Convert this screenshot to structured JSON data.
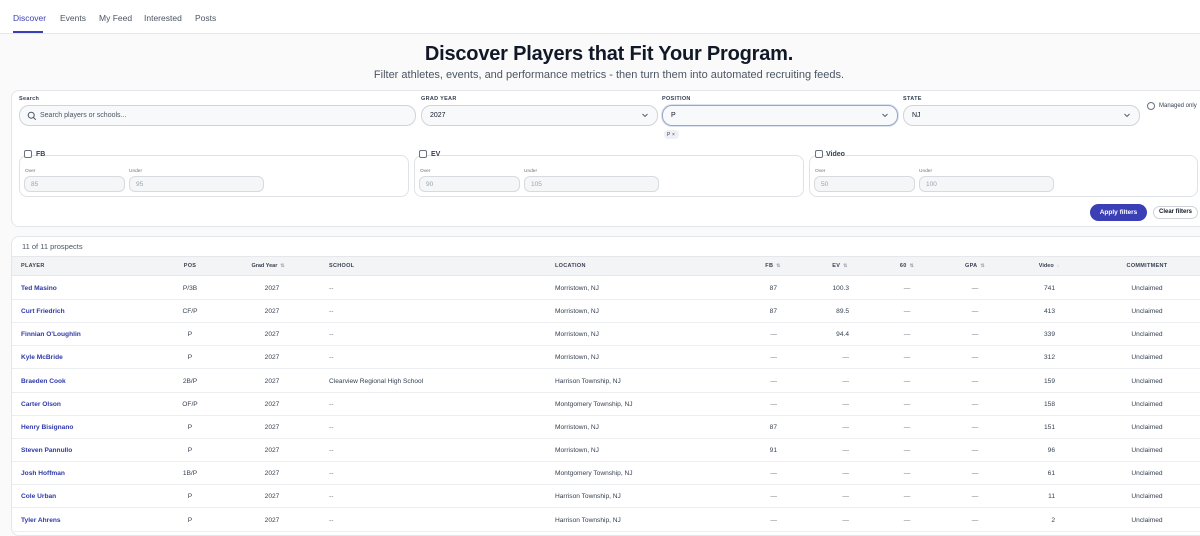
{
  "nav": {
    "tabs": [
      "Discover",
      "Events",
      "My Feed",
      "Interested",
      "Posts"
    ]
  },
  "hero": {
    "title": "Discover Players that Fit Your Program.",
    "subtitle": "Filter athletes, events, and performance metrics - then turn them into automated recruiting feeds."
  },
  "filters": {
    "search_label": "Search",
    "search_placeholder": "Search players or schools...",
    "grad_year_label": "GRAD YEAR",
    "grad_year_value": "2027",
    "position_label": "POSITION",
    "position_value": "P",
    "position_chip": "P",
    "position_chip_remove": "×",
    "state_label": "STATE",
    "state_value": "NJ",
    "managed_only_label": "Managed only",
    "metrics": [
      {
        "label": "FB",
        "over_label": "Over",
        "under_label": "Under",
        "over_placeholder": "85",
        "under_placeholder": "95"
      },
      {
        "label": "EV",
        "over_label": "Over",
        "under_label": "Under",
        "over_placeholder": "90",
        "under_placeholder": "105"
      },
      {
        "label": "Video",
        "over_label": "Over",
        "under_label": "Under",
        "over_placeholder": "50",
        "under_placeholder": "100"
      }
    ],
    "apply_label": "Apply filters",
    "clear_label": "Clear filters"
  },
  "results": {
    "count_text": "11 of 11 prospects",
    "columns": [
      "PLAYER",
      "POS",
      "Grad Year",
      "SCHOOL",
      "LOCATION",
      "FB",
      "EV",
      "60",
      "GPA",
      "Video",
      "COMMITMENT"
    ],
    "sort_asc_icon": "⇅",
    "sort_desc_icon": "↓",
    "rows": [
      {
        "player": "Ted Masino",
        "pos": "P/3B",
        "grad": "2027",
        "school": "--",
        "location": "Morristown, NJ",
        "fb": "87",
        "ev": "100.3",
        "sixty": "—",
        "gpa": "—",
        "video": "741",
        "commitment": "Unclaimed"
      },
      {
        "player": "Curt Friedrich",
        "pos": "CF/P",
        "grad": "2027",
        "school": "--",
        "location": "Morristown, NJ",
        "fb": "87",
        "ev": "89.5",
        "sixty": "—",
        "gpa": "—",
        "video": "413",
        "commitment": "Unclaimed"
      },
      {
        "player": "Finnian O'Loughlin",
        "pos": "P",
        "grad": "2027",
        "school": "--",
        "location": "Morristown, NJ",
        "fb": "—",
        "ev": "94.4",
        "sixty": "—",
        "gpa": "—",
        "video": "339",
        "commitment": "Unclaimed"
      },
      {
        "player": "Kyle McBride",
        "pos": "P",
        "grad": "2027",
        "school": "--",
        "location": "Morristown, NJ",
        "fb": "—",
        "ev": "—",
        "sixty": "—",
        "gpa": "—",
        "video": "312",
        "commitment": "Unclaimed"
      },
      {
        "player": "Braeden Cook",
        "pos": "2B/P",
        "grad": "2027",
        "school": "Clearview Regional High School",
        "location": "Harrison Township, NJ",
        "fb": "—",
        "ev": "—",
        "sixty": "—",
        "gpa": "—",
        "video": "159",
        "commitment": "Unclaimed"
      },
      {
        "player": "Carter Olson",
        "pos": "OF/P",
        "grad": "2027",
        "school": "--",
        "location": "Montgomery Township, NJ",
        "fb": "—",
        "ev": "—",
        "sixty": "—",
        "gpa": "—",
        "video": "158",
        "commitment": "Unclaimed"
      },
      {
        "player": "Henry Bisignano",
        "pos": "P",
        "grad": "2027",
        "school": "--",
        "location": "Morristown, NJ",
        "fb": "87",
        "ev": "—",
        "sixty": "—",
        "gpa": "—",
        "video": "151",
        "commitment": "Unclaimed"
      },
      {
        "player": "Steven Pannullo",
        "pos": "P",
        "grad": "2027",
        "school": "--",
        "location": "Morristown, NJ",
        "fb": "91",
        "ev": "—",
        "sixty": "—",
        "gpa": "—",
        "video": "96",
        "commitment": "Unclaimed"
      },
      {
        "player": "Josh Hoffman",
        "pos": "1B/P",
        "grad": "2027",
        "school": "--",
        "location": "Montgomery Township, NJ",
        "fb": "—",
        "ev": "—",
        "sixty": "—",
        "gpa": "—",
        "video": "61",
        "commitment": "Unclaimed"
      },
      {
        "player": "Cole Urban",
        "pos": "P",
        "grad": "2027",
        "school": "--",
        "location": "Harrison Township, NJ",
        "fb": "—",
        "ev": "—",
        "sixty": "—",
        "gpa": "—",
        "video": "11",
        "commitment": "Unclaimed"
      },
      {
        "player": "Tyler Ahrens",
        "pos": "P",
        "grad": "2027",
        "school": "--",
        "location": "Harrison Township, NJ",
        "fb": "—",
        "ev": "—",
        "sixty": "—",
        "gpa": "—",
        "video": "2",
        "commitment": "Unclaimed"
      }
    ]
  },
  "colors": {
    "accent": "#3b3fb6",
    "link": "#2f3aa8"
  }
}
